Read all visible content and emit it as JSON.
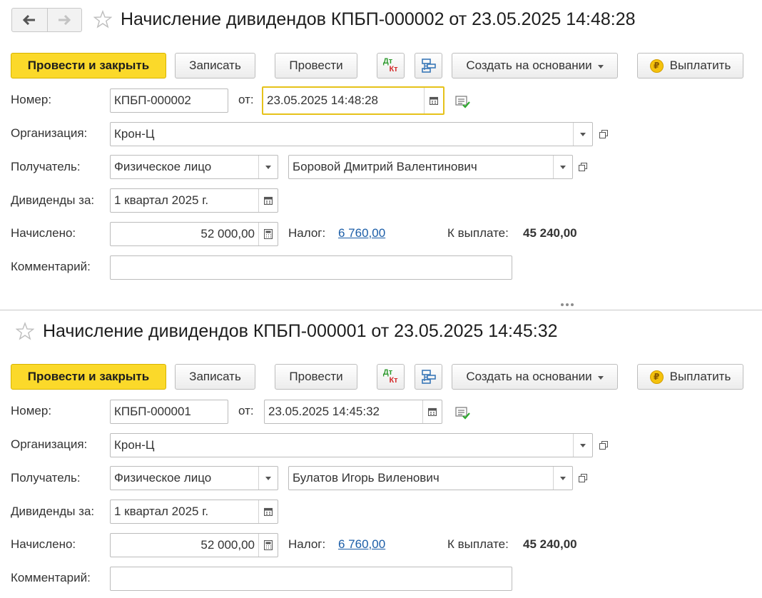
{
  "docs": [
    {
      "title": "Начисление дивидендов КПБП-000002 от 23.05.2025 14:48:28",
      "toolbar": {
        "post_close": "Провести и закрыть",
        "save": "Записать",
        "post": "Провести",
        "dt": "Дт",
        "kt": "Кт",
        "create_based": "Создать на основании",
        "pay": "Выплатить",
        "pay_icon": "₽"
      },
      "fields": {
        "number_label": "Номер:",
        "number": "КПБП-000002",
        "from_label": "от:",
        "date": "23.05.2025 14:48:28",
        "org_label": "Организация:",
        "org": "Крон-Ц",
        "recipient_label": "Получатель:",
        "recipient_type": "Физическое лицо",
        "recipient": "Боровой Дмитрий Валентинович",
        "period_label": "Дивиденды за:",
        "period": "1 квартал 2025 г.",
        "accrued_label": "Начислено:",
        "accrued": "52 000,00",
        "tax_label": "Налог:",
        "tax": "6 760,00",
        "payout_label": "К выплате:",
        "payout": "45 240,00",
        "comment_label": "Комментарий:",
        "comment": ""
      }
    },
    {
      "title": "Начисление дивидендов КПБП-000001 от 23.05.2025 14:45:32",
      "toolbar": {
        "post_close": "Провести и закрыть",
        "save": "Записать",
        "post": "Провести",
        "dt": "Дт",
        "kt": "Кт",
        "create_based": "Создать на основании",
        "pay": "Выплатить",
        "pay_icon": "₽"
      },
      "fields": {
        "number_label": "Номер:",
        "number": "КПБП-000001",
        "from_label": "от:",
        "date": "23.05.2025 14:45:32",
        "org_label": "Организация:",
        "org": "Крон-Ц",
        "recipient_label": "Получатель:",
        "recipient_type": "Физическое лицо",
        "recipient": "Булатов Игорь Виленович",
        "period_label": "Дивиденды за:",
        "period": "1 квартал 2025 г.",
        "accrued_label": "Начислено:",
        "accrued": "52 000,00",
        "tax_label": "Налог:",
        "tax": "6 760,00",
        "payout_label": "К выплате:",
        "payout": "45 240,00",
        "comment_label": "Комментарий:",
        "comment": ""
      }
    }
  ],
  "colors": {
    "primary_button": "#fbd92a",
    "focus_border": "#e6c21a",
    "link": "#1c5ea8",
    "dt_green": "#2e9a2e",
    "kt_red": "#d42a2a"
  }
}
